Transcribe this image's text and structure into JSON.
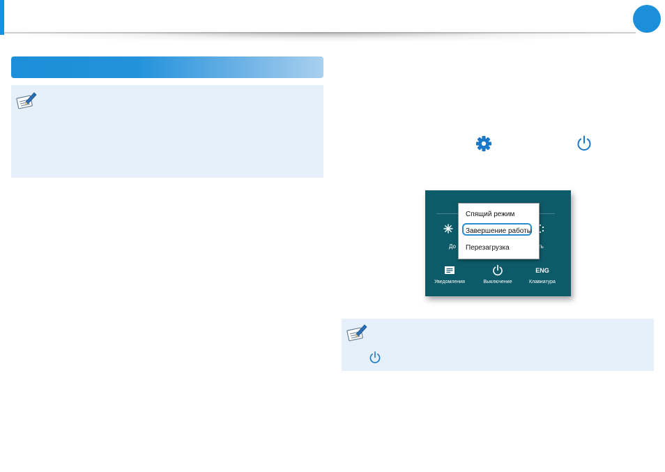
{
  "header": {
    "accent_color": "#1b8fd9",
    "page_badge_color": "#1b8fd9"
  },
  "section": {
    "bar_color": "#1b8fd9"
  },
  "notes": {
    "icon": "memo-pencil-icon",
    "background": "#e5f0fa"
  },
  "inline_icons": {
    "settings": "gear-icon",
    "power": "power-icon"
  },
  "screenshot": {
    "background": "#0d5a68",
    "power_menu": {
      "items": [
        "Спящий режим",
        "Завершение работы",
        "Перезагрузка"
      ],
      "highlighted_index": 1,
      "highlight_color": "#2a8fd0"
    },
    "peek_left_label": "До",
    "peek_right_label": "сть",
    "tray": [
      {
        "icon": "notification-icon",
        "label": "Уведомления"
      },
      {
        "icon": "power-icon",
        "label": "Выключение"
      },
      {
        "icon_text": "ENG",
        "label": "Клавиатура"
      }
    ]
  }
}
